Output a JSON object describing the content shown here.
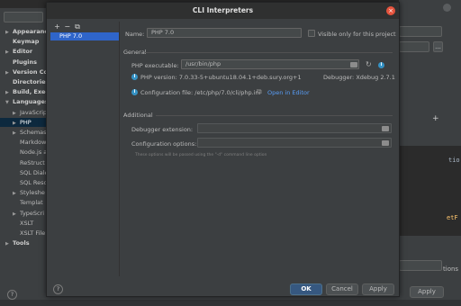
{
  "settings_tree": [
    {
      "label": "Appearance",
      "arrow": "▶",
      "bold": true
    },
    {
      "label": "Keymap",
      "arrow": "",
      "bold": true
    },
    {
      "label": "Editor",
      "arrow": "▶",
      "bold": true
    },
    {
      "label": "Plugins",
      "arrow": "",
      "bold": true
    },
    {
      "label": "Version Co",
      "arrow": "▶",
      "bold": true
    },
    {
      "label": "Directories",
      "arrow": "",
      "bold": true
    },
    {
      "label": "Build, Exec",
      "arrow": "▶",
      "bold": true
    },
    {
      "label": "Languages",
      "arrow": "▼",
      "bold": true
    },
    {
      "label": "JavaScrip",
      "arrow": "▶",
      "bold": false
    },
    {
      "label": "PHP",
      "arrow": "▶",
      "bold": false,
      "selected": true
    },
    {
      "label": "Schemas",
      "arrow": "▶",
      "bold": false
    },
    {
      "label": "Markdow",
      "arrow": "",
      "bold": false
    },
    {
      "label": "Node.js a",
      "arrow": "",
      "bold": false
    },
    {
      "label": "ReStruct",
      "arrow": "",
      "bold": false
    },
    {
      "label": "SQL Diale",
      "arrow": "",
      "bold": false
    },
    {
      "label": "SQL Reso",
      "arrow": "",
      "bold": false
    },
    {
      "label": "Styleshe",
      "arrow": "▶",
      "bold": false
    },
    {
      "label": "Templat",
      "arrow": "",
      "bold": false
    },
    {
      "label": "TypeScri",
      "arrow": "▶",
      "bold": false
    },
    {
      "label": "XSLT",
      "arrow": "",
      "bold": false
    },
    {
      "label": "XSLT File",
      "arrow": "",
      "bold": false
    },
    {
      "label": "Tools",
      "arrow": "▶",
      "bold": true
    }
  ],
  "background": {
    "editor_text_1": "tio",
    "editor_text_2": "etF",
    "right_tab_text": "tions",
    "apply_label": "Apply",
    "more_label": "..."
  },
  "dialog": {
    "title": "CLI Interpreters",
    "close_glyph": "×",
    "list_toolbar": {
      "add": "+",
      "remove": "−",
      "copy": "⧉"
    },
    "interpreters": [
      "PHP 7.0"
    ],
    "name_label": "Name:",
    "name_value": "PHP 7.0",
    "visible_only_label": "Visible only for this project",
    "general_label": "General",
    "php_executable_label": "PHP executable:",
    "php_executable_value": "/usr/bin/php",
    "php_version_text": "PHP version: 7.0.33-5+ubuntu18.04.1+deb.sury.org+1",
    "debugger_text": "Debugger: Xdebug 2.7.1",
    "config_file_text": "Configuration file: /etc/php/7.0/cli/php.ini",
    "open_in_editor_label": "Open in Editor",
    "additional_label": "Additional",
    "debugger_extension_label": "Debugger extension:",
    "debugger_extension_value": "",
    "config_options_label": "Configuration options:",
    "config_options_value": "",
    "config_options_hint": "These options will be passed using the \"-d\" command line option",
    "ok_label": "OK",
    "cancel_label": "Cancel",
    "apply_label": "Apply",
    "help_glyph": "?"
  },
  "colors": {
    "background": "#3c3f41",
    "selection": "#2f65ca",
    "ok_button": "#365880",
    "close_button": "#e4533d",
    "link": "#589df6",
    "info_icon": "#3592c4"
  }
}
